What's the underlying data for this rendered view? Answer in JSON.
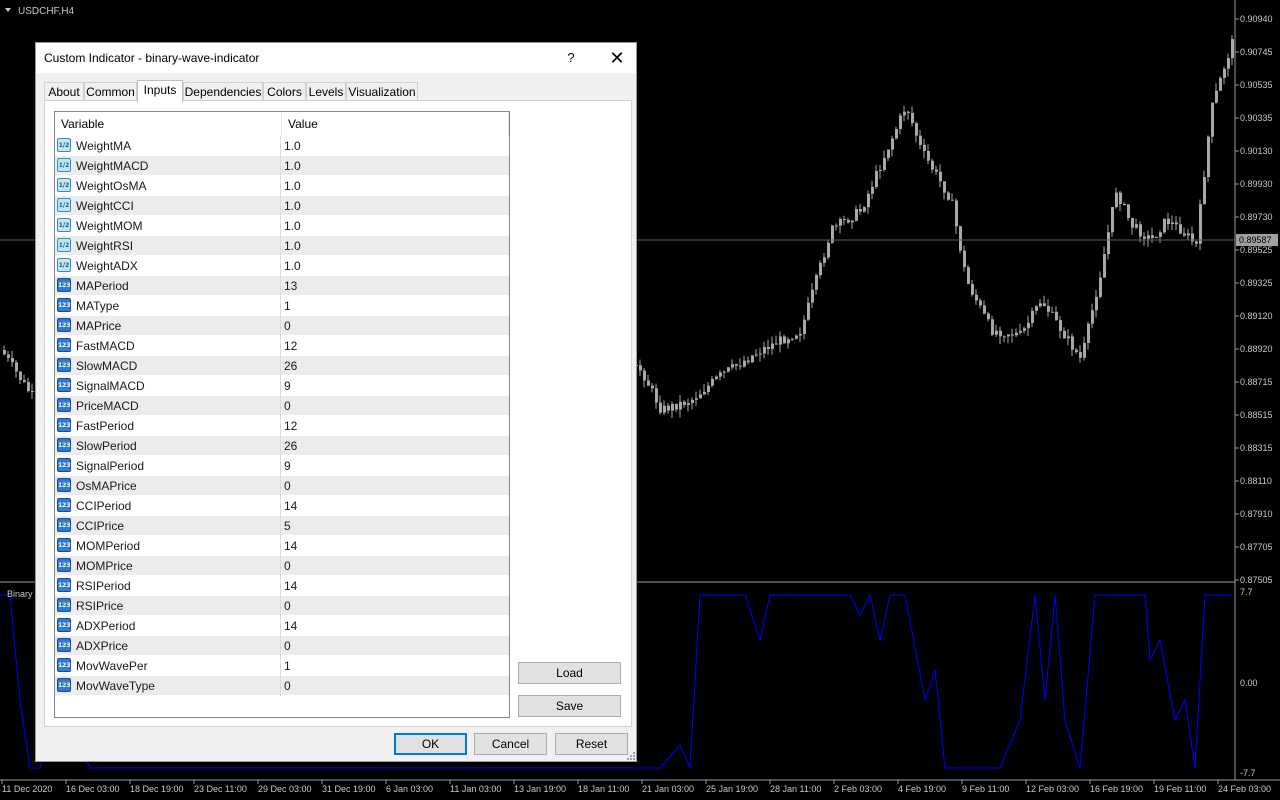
{
  "chart": {
    "symbol_label": "USDCHF,H4",
    "indicator_label": "Binary",
    "current_price": "0.89587",
    "price_ticks": [
      "0.90940",
      "0.90745",
      "0.90535",
      "0.90335",
      "0.90130",
      "0.89930",
      "0.89730",
      "0.89525",
      "0.89325",
      "0.89120",
      "0.88920",
      "0.88715",
      "0.88515",
      "0.88315",
      "0.88110",
      "0.87910",
      "0.87705",
      "0.87505"
    ],
    "indicator_ticks": [
      "7.7",
      "0.00",
      "-7.7"
    ],
    "time_ticks": [
      "11 Dec 2020",
      "16 Dec 03:00",
      "18 Dec 19:00",
      "23 Dec 11:00",
      "29 Dec 03:00",
      "31 Dec 19:00",
      "6 Jan 03:00",
      "11 Jan 03:00",
      "13 Jan 19:00",
      "18 Jan 11:00",
      "21 Jan 03:00",
      "25 Jan 19:00",
      "28 Jan 11:00",
      "2 Feb 03:00",
      "4 Feb 19:00",
      "9 Feb 11:00",
      "12 Feb 03:00",
      "16 Feb 19:00",
      "19 Feb 11:00",
      "24 Feb 03:00"
    ],
    "colors": {
      "background": "#000000",
      "candle": "#a8a8a8",
      "indicator_line": "#0000ff",
      "axis_text": "#c8c8c8"
    }
  },
  "dialog": {
    "title": "Custom Indicator - binary-wave-indicator",
    "help_label": "?",
    "close_label": "✕",
    "tabs": [
      "About",
      "Common",
      "Inputs",
      "Dependencies",
      "Colors",
      "Levels",
      "Visualization"
    ],
    "active_tab": "Inputs",
    "table": {
      "headers": [
        "Variable",
        "Value"
      ],
      "rows": [
        {
          "name": "WeightMA",
          "value": "1.0",
          "type": "double"
        },
        {
          "name": "WeightMACD",
          "value": "1.0",
          "type": "double"
        },
        {
          "name": "WeightOsMA",
          "value": "1.0",
          "type": "double"
        },
        {
          "name": "WeightCCI",
          "value": "1.0",
          "type": "double"
        },
        {
          "name": "WeightMOM",
          "value": "1.0",
          "type": "double"
        },
        {
          "name": "WeightRSI",
          "value": "1.0",
          "type": "double"
        },
        {
          "name": "WeightADX",
          "value": "1.0",
          "type": "double"
        },
        {
          "name": "MAPeriod",
          "value": "13",
          "type": "int"
        },
        {
          "name": "MAType",
          "value": "1",
          "type": "int"
        },
        {
          "name": "MAPrice",
          "value": "0",
          "type": "int"
        },
        {
          "name": "FastMACD",
          "value": "12",
          "type": "int"
        },
        {
          "name": "SlowMACD",
          "value": "26",
          "type": "int"
        },
        {
          "name": "SignalMACD",
          "value": "9",
          "type": "int"
        },
        {
          "name": "PriceMACD",
          "value": "0",
          "type": "int"
        },
        {
          "name": "FastPeriod",
          "value": "12",
          "type": "int"
        },
        {
          "name": "SlowPeriod",
          "value": "26",
          "type": "int"
        },
        {
          "name": "SignalPeriod",
          "value": "9",
          "type": "int"
        },
        {
          "name": "OsMAPrice",
          "value": "0",
          "type": "int"
        },
        {
          "name": "CCIPeriod",
          "value": "14",
          "type": "int"
        },
        {
          "name": "CCIPrice",
          "value": "5",
          "type": "int"
        },
        {
          "name": "MOMPeriod",
          "value": "14",
          "type": "int"
        },
        {
          "name": "MOMPrice",
          "value": "0",
          "type": "int"
        },
        {
          "name": "RSIPeriod",
          "value": "14",
          "type": "int"
        },
        {
          "name": "RSIPrice",
          "value": "0",
          "type": "int"
        },
        {
          "name": "ADXPeriod",
          "value": "14",
          "type": "int"
        },
        {
          "name": "ADXPrice",
          "value": "0",
          "type": "int"
        },
        {
          "name": "MovWavePer",
          "value": "1",
          "type": "int"
        },
        {
          "name": "MovWaveType",
          "value": "0",
          "type": "int"
        }
      ]
    },
    "icons": {
      "double": "1/2",
      "int": "123"
    },
    "side_buttons": {
      "load": "Load",
      "save": "Save"
    },
    "footer_buttons": {
      "ok": "OK",
      "cancel": "Cancel",
      "reset": "Reset"
    }
  }
}
